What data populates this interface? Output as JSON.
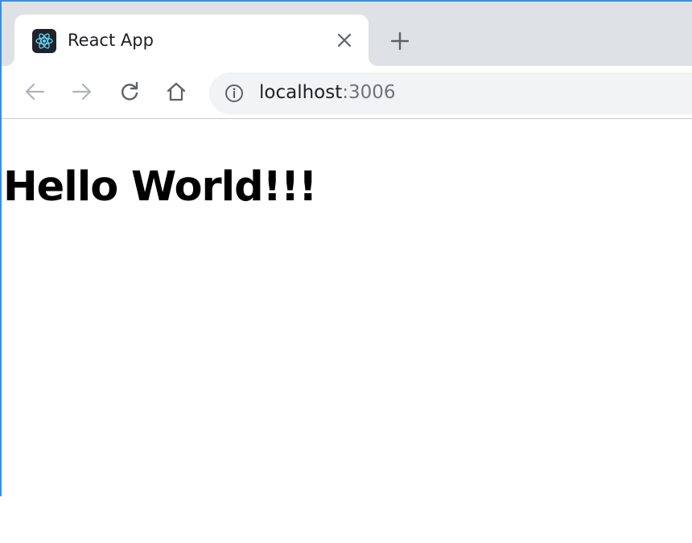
{
  "browser": {
    "tab": {
      "title": "React App",
      "favicon": "react-logo-icon"
    },
    "icons": {
      "close": "close-icon",
      "new_tab": "plus-icon",
      "back": "back-arrow-icon",
      "forward": "forward-arrow-icon",
      "reload": "reload-icon",
      "home": "home-icon",
      "info": "info-icon"
    },
    "address_bar": {
      "host": "localhost",
      "port": ":3006"
    },
    "colors": {
      "accent_border": "#3c8de0",
      "tabstrip": "#dee1e6",
      "omnibox": "#f1f3f4",
      "react_cyan": "#61dafb"
    }
  },
  "page": {
    "heading": "Hello World!!!"
  }
}
